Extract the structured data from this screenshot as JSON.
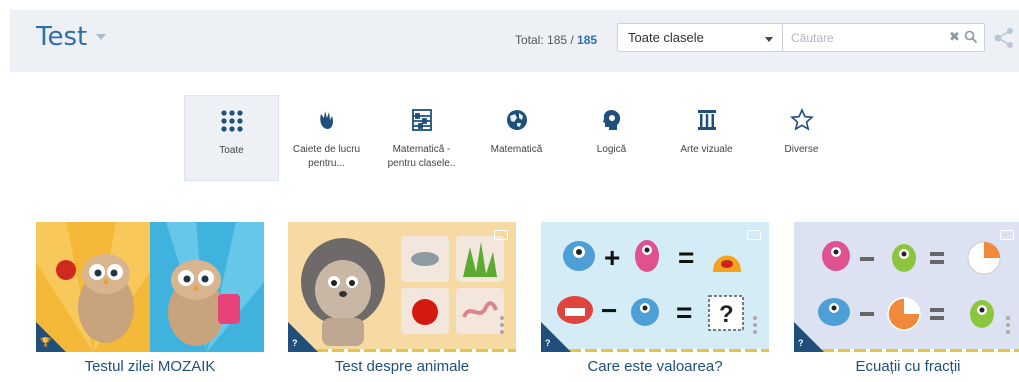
{
  "header": {
    "title": "Test",
    "total_prefix": "Total: 185 / ",
    "total_count": "185",
    "class_select": "Toate clasele",
    "search_placeholder": "Căutare"
  },
  "categories": [
    {
      "label": "Toate",
      "icon": "grid-icon"
    },
    {
      "label": "Caiete de lucru pentru...",
      "icon": "hand-icon"
    },
    {
      "label": "Matematică - pentru clasele..",
      "icon": "abacus-icon"
    },
    {
      "label": "Matematică",
      "icon": "globe-icon"
    },
    {
      "label": "Logică",
      "icon": "head-icon"
    },
    {
      "label": "Arte vizuale",
      "icon": "column-icon"
    },
    {
      "label": "Diverse",
      "icon": "star-icon"
    }
  ],
  "cards": [
    {
      "caption": "Testul zilei MOZAIK",
      "badge_icon": "trophy-icon"
    },
    {
      "caption": "Test despre animale",
      "badge_icon": "question-icon"
    },
    {
      "caption": "Care este valoarea?",
      "badge_icon": "question-icon"
    },
    {
      "caption": "Ecuații cu fracții",
      "badge_icon": "question-icon"
    }
  ],
  "thumbnail_text": {
    "plus": "+",
    "equals": "=",
    "minus": "−",
    "unknown": "?"
  },
  "colors": {
    "brand": "#2d6fa6",
    "badge": "#1f4f7a",
    "header_bg": "#edf1f6"
  }
}
